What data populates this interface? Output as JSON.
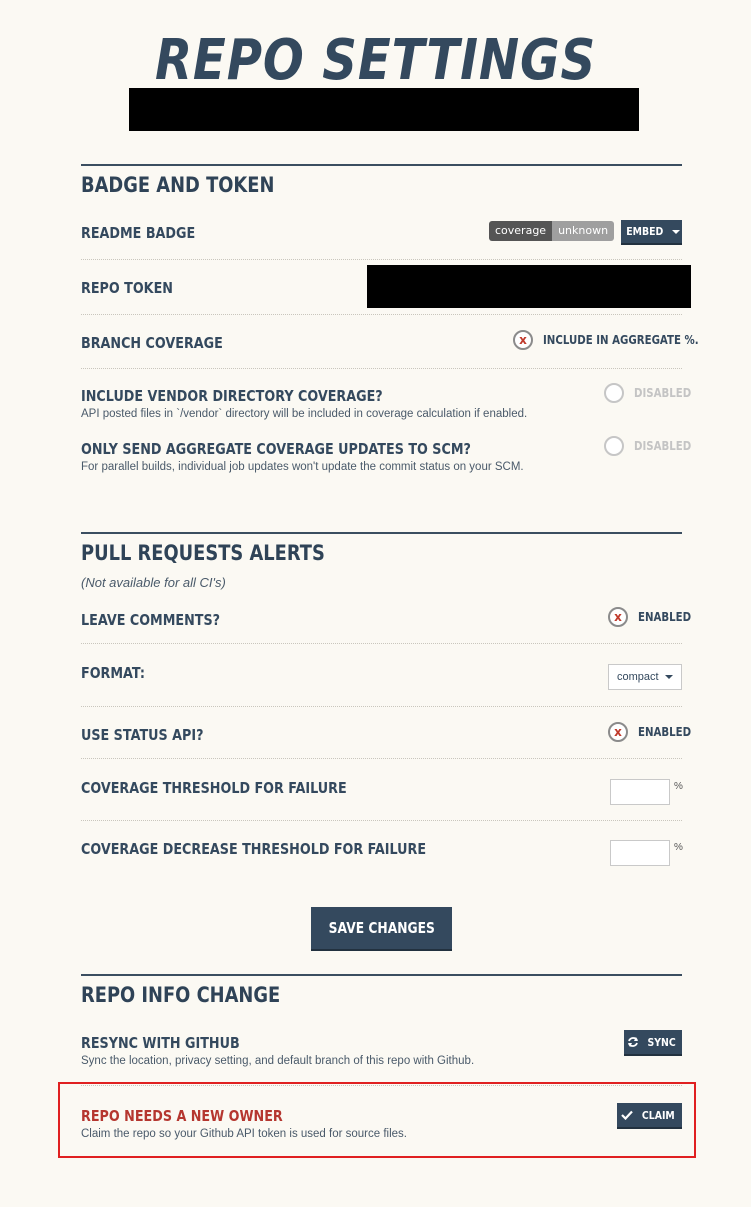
{
  "header": {
    "title": "REPO SETTINGS"
  },
  "badge_token": {
    "title": "BADGE AND TOKEN",
    "readme_badge": {
      "label": "README BADGE",
      "badge_left": "coverage",
      "badge_right": "unknown",
      "embed_label": "EMBED"
    },
    "repo_token": {
      "label": "REPO TOKEN"
    },
    "branch_coverage": {
      "label": "BRANCH COVERAGE",
      "toggle_label": "INCLUDE IN AGGREGATE %.",
      "enabled": true
    },
    "vendor": {
      "label": "INCLUDE VENDOR DIRECTORY COVERAGE?",
      "desc": "API posted files in `/vendor` directory will be included in coverage calculation if enabled.",
      "toggle_label": "DISABLED",
      "enabled": false
    },
    "aggregate_only": {
      "label": "ONLY SEND AGGREGATE COVERAGE UPDATES TO SCM?",
      "desc": "For parallel builds, individual job updates won't update the commit status on your SCM.",
      "toggle_label": "DISABLED",
      "enabled": false
    }
  },
  "pull_requests": {
    "title": "PULL REQUESTS ALERTS",
    "note": "(Not available for all CI's)",
    "leave_comments": {
      "label": "LEAVE COMMENTS?",
      "toggle_label": "ENABLED",
      "enabled": true
    },
    "format": {
      "label": "FORMAT:",
      "selected": "compact"
    },
    "status_api": {
      "label": "USE STATUS API?",
      "toggle_label": "ENABLED",
      "enabled": true
    },
    "threshold": {
      "label": "COVERAGE THRESHOLD FOR FAILURE",
      "value": "",
      "unit": "%"
    },
    "decrease_threshold": {
      "label": "COVERAGE DECREASE THRESHOLD FOR FAILURE",
      "value": "",
      "unit": "%"
    }
  },
  "save_label": "SAVE CHANGES",
  "repo_info": {
    "title": "REPO INFO CHANGE",
    "resync": {
      "label": "RESYNC WITH GITHUB",
      "desc": "Sync the location, privacy setting, and default branch of this repo with Github.",
      "button": "SYNC"
    },
    "owner": {
      "label": "REPO NEEDS A NEW OWNER",
      "desc": "Claim the repo so your Github API token is used for source files.",
      "button": "CLAIM"
    }
  },
  "colors": {
    "primary": "#34495e",
    "background": "#fbf9f3",
    "warning": "#b5362f",
    "highlight": "#e02020"
  }
}
